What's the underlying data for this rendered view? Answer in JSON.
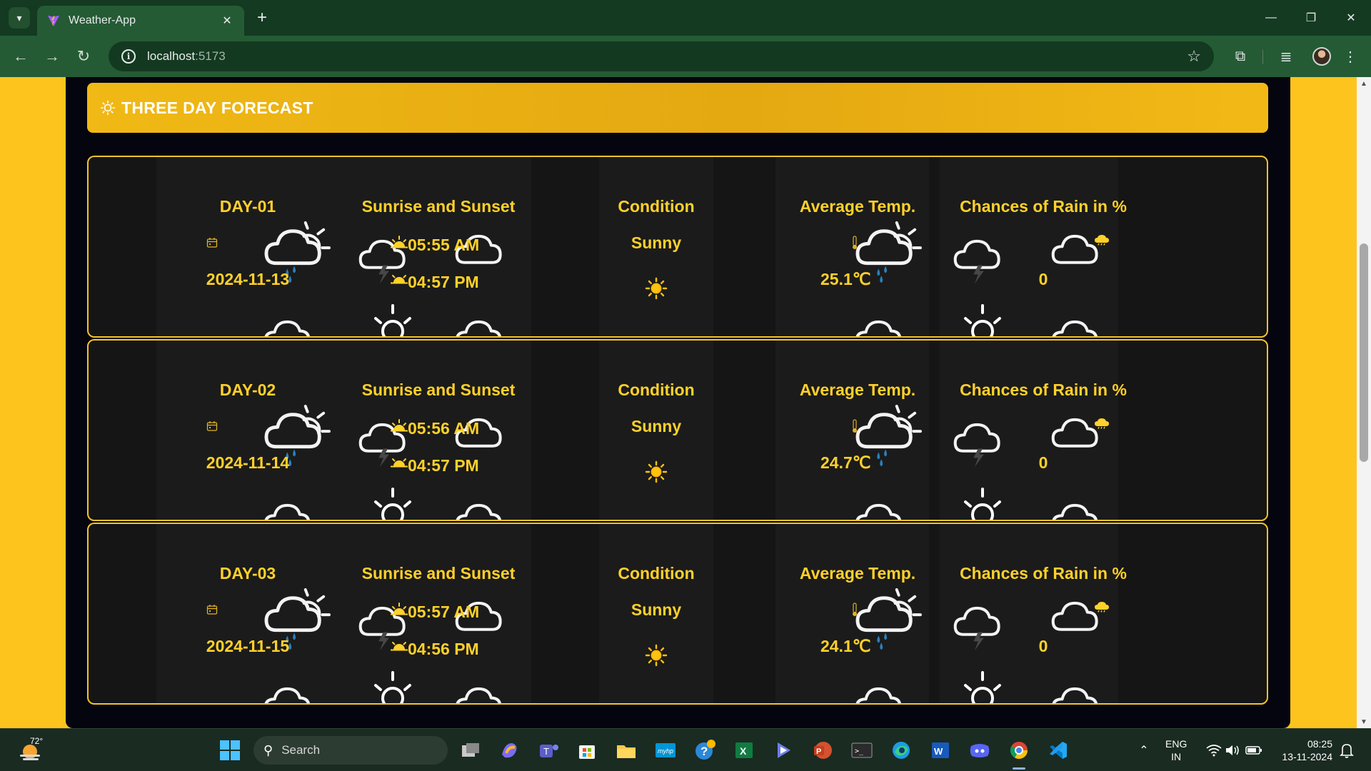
{
  "browser": {
    "tab_title": "Weather-App",
    "url_host": "localhost",
    "url_port": ":5173"
  },
  "page": {
    "header_title": "THREE DAY FORECAST",
    "days": [
      {
        "day_label": "DAY-01",
        "date": "2024-11-13",
        "sunrise_title": "Sunrise and Sunset",
        "sunrise": "05:55 AM",
        "sunset": "04:57 PM",
        "condition_title": "Condition",
        "condition": "Sunny",
        "temp_title": "Average Temp.",
        "temp": "25.1℃",
        "rain_title": "Chances of Rain in %",
        "rain": "0"
      },
      {
        "day_label": "DAY-02",
        "date": "2024-11-14",
        "sunrise_title": "Sunrise and Sunset",
        "sunrise": "05:56 AM",
        "sunset": "04:57 PM",
        "condition_title": "Condition",
        "condition": "Sunny",
        "temp_title": "Average Temp.",
        "temp": "24.7℃",
        "rain_title": "Chances of Rain in %",
        "rain": "0"
      },
      {
        "day_label": "DAY-03",
        "date": "2024-11-15",
        "sunrise_title": "Sunrise and Sunset",
        "sunrise": "05:57 AM",
        "sunset": "04:56 PM",
        "condition_title": "Condition",
        "condition": "Sunny",
        "temp_title": "Average Temp.",
        "temp": "24.1℃",
        "rain_title": "Chances of Rain in %",
        "rain": "0"
      }
    ]
  },
  "taskbar": {
    "weather_temp": "72°",
    "search_label": "Search",
    "lang_line1": "ENG",
    "lang_line2": "IN",
    "time": "08:25",
    "date": "13-11-2024"
  },
  "colors": {
    "page_bg": "#fcc41c",
    "panel_bg": "#04050f",
    "accent_text": "#ffd12a",
    "header_bg": "#eeb414"
  }
}
